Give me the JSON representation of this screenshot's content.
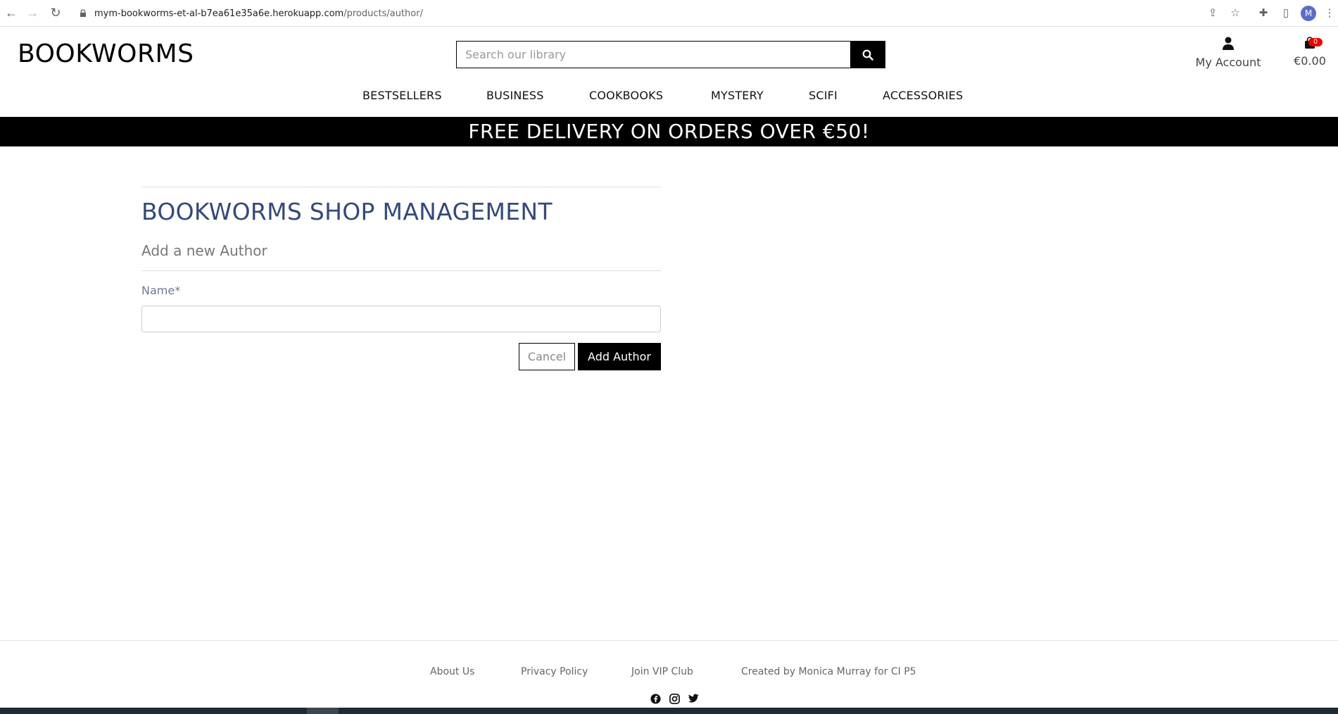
{
  "browser": {
    "url_host": "mym-bookworms-et-al-b7ea61e35a6e.herokuapp.com",
    "url_path": "/products/author/",
    "profile_initial": "M"
  },
  "header": {
    "logo": "BOOKWORMS",
    "search_placeholder": "Search our library",
    "account_label": "My Account",
    "cart_total": "€0.00",
    "cart_count": "0"
  },
  "nav": {
    "items": [
      "BESTSELLERS",
      "BUSINESS",
      "COOKBOOKS",
      "MYSTERY",
      "SCIFI",
      "ACCESSORIES"
    ]
  },
  "banner": {
    "text": "FREE DELIVERY ON ORDERS OVER €50!"
  },
  "main": {
    "title": "BOOKWORMS SHOP MANAGEMENT",
    "subtitle": "Add a new Author",
    "name_label": "Name*",
    "name_value": "",
    "cancel_label": "Cancel",
    "submit_label": "Add Author"
  },
  "footer": {
    "links": [
      "About Us",
      "Privacy Policy",
      "Join VIP Club",
      "Created by Monica Murray for CI P5"
    ],
    "social_icons": [
      "facebook-icon",
      "instagram-icon",
      "twitter-icon"
    ]
  },
  "colors": {
    "title": "#34497a",
    "banner_bg": "#000000",
    "cart_badge": "#ee0000"
  }
}
